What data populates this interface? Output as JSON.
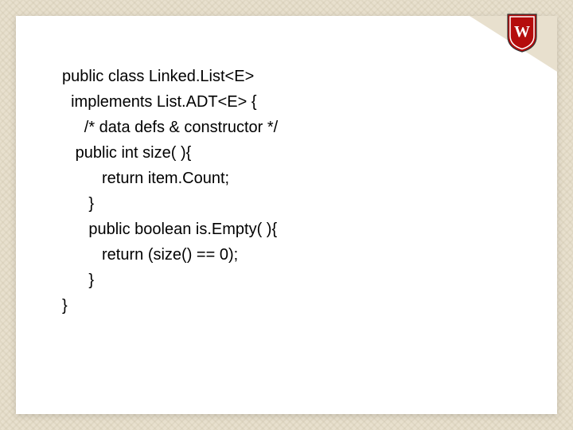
{
  "code": {
    "l1": "public class Linked.List<E>",
    "l2": "  implements List.ADT<E> {",
    "l3": "     /* data defs & constructor */",
    "l4": "",
    "l5": "   public int size( ){",
    "l6": "         return item.Count;",
    "l7": "      }",
    "l8": "      public boolean is.Empty( ){",
    "l9": "         return (size() == 0);",
    "l10": "      }",
    "l11": "}"
  }
}
